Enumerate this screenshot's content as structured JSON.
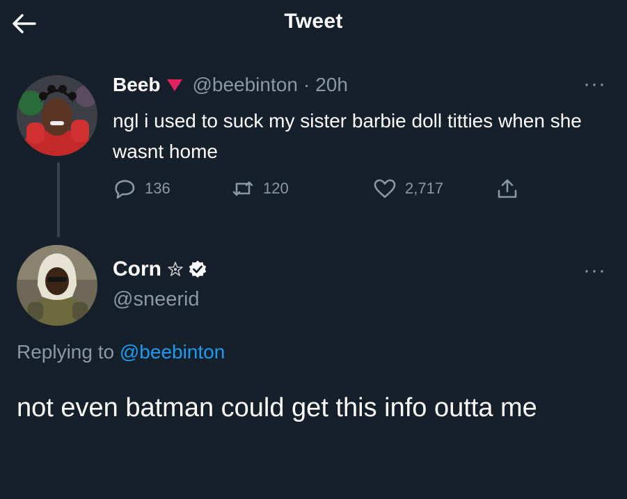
{
  "header": {
    "title": "Tweet"
  },
  "tweet": {
    "author_name": "Beeb",
    "author_handle": "@beebinton",
    "separator": "·",
    "time": "20h",
    "more_label": "···",
    "text": "ngl i used to suck my sister barbie doll titties when she wasnt home",
    "replies": "136",
    "retweets": "120",
    "likes": "2,717"
  },
  "reply": {
    "author_name": "Corn",
    "author_handle": "@sneerid",
    "more_label": "···",
    "replying_prefix": "Replying to",
    "replying_handle": "@beebinton",
    "text": "not even batman could get this info outta me"
  },
  "colors": {
    "background": "#15202b",
    "muted": "#8b98a5",
    "accent": "#1d9bf0",
    "flag": "#e0245e"
  },
  "icons": [
    "back-arrow-icon",
    "red-triangle-icon",
    "more-icon",
    "reply-icon",
    "retweet-icon",
    "like-icon",
    "share-icon",
    "star-icon",
    "verified-icon"
  ]
}
